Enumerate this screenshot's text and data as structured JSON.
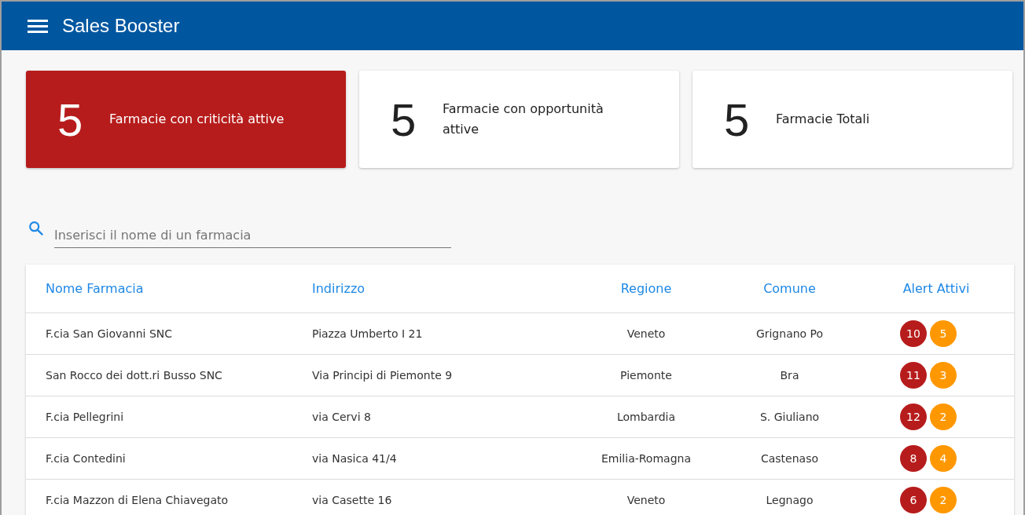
{
  "app_bar": {
    "title": "Sales Booster"
  },
  "summary_cards": [
    {
      "value": "5",
      "label": "Farmacie con criticità attive",
      "highlighted": true
    },
    {
      "value": "5",
      "label": "Farmacie con opportunità attive",
      "highlighted": false
    },
    {
      "value": "5",
      "label": "Farmacie Totali",
      "highlighted": false
    }
  ],
  "search": {
    "placeholder": "Inserisci il nome di un farmacia"
  },
  "table": {
    "columns": [
      "Nome Farmacia",
      "Indirizzo",
      "Regione",
      "Comune",
      "Alert Attivi"
    ],
    "rows": [
      {
        "cells": [
          "F.cia San Giovanni SNC",
          "Piazza Umberto I 21",
          "Veneto",
          "Grignano Po"
        ],
        "alerts": [
          {
            "count": "10",
            "color": "#b71c1c"
          },
          {
            "count": "5",
            "color": "#ff9800"
          }
        ]
      },
      {
        "cells": [
          "San Rocco dei dott.ri Busso SNC",
          "Via Principi di Piemonte 9",
          "Piemonte",
          "Bra"
        ],
        "alerts": [
          {
            "count": "11",
            "color": "#b71c1c"
          },
          {
            "count": "3",
            "color": "#ff9800"
          }
        ]
      },
      {
        "cells": [
          "F.cia Pellegrini",
          "via Cervi 8",
          "Lombardia",
          "S. Giuliano"
        ],
        "alerts": [
          {
            "count": "12",
            "color": "#b71c1c"
          },
          {
            "count": "2",
            "color": "#ff9800"
          }
        ]
      },
      {
        "cells": [
          "F.cia Contedini",
          "via Nasica 41/4",
          "Emilia-Romagna",
          "Castenaso"
        ],
        "alerts": [
          {
            "count": "8",
            "color": "#b71c1c"
          },
          {
            "count": "4",
            "color": "#ff9800"
          }
        ]
      },
      {
        "cells": [
          "F.cia Mazzon di Elena Chiavegato",
          "via Casette 16",
          "Veneto",
          "Legnago"
        ],
        "alerts": [
          {
            "count": "6",
            "color": "#b71c1c"
          },
          {
            "count": "2",
            "color": "#ff9800"
          }
        ]
      }
    ]
  }
}
